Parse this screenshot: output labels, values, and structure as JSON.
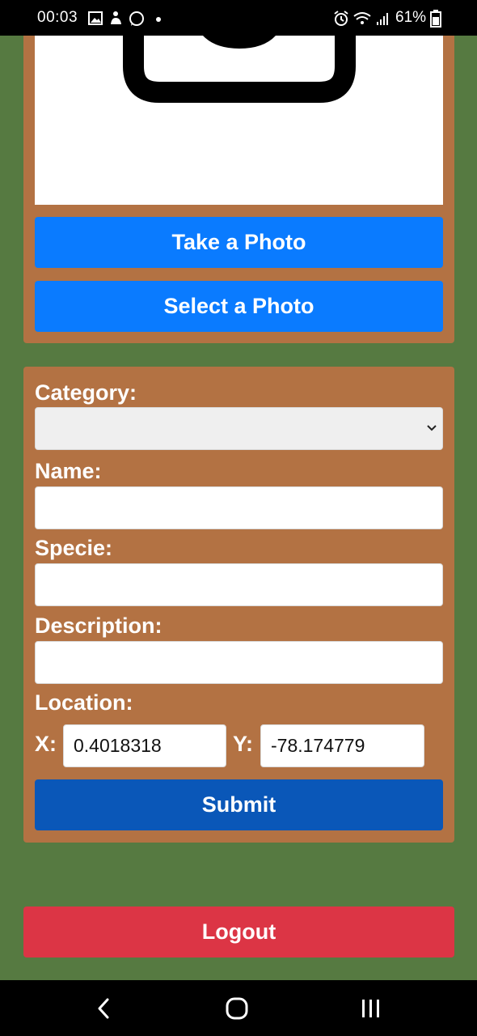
{
  "status_bar": {
    "time": "00:03",
    "battery": "61%",
    "icons_left": [
      "image-icon",
      "fitness-icon",
      "whatsapp-icon",
      "dot-icon"
    ],
    "icons_right": [
      "alarm-icon",
      "wifi-icon",
      "signal-icon",
      "battery-icon"
    ]
  },
  "photo_section": {
    "preview_icon": "camera-icon",
    "take_photo_label": "Take a Photo",
    "select_photo_label": "Select a Photo"
  },
  "form": {
    "category_label": "Category:",
    "category_value": "",
    "name_label": "Name:",
    "name_value": "",
    "specie_label": "Specie:",
    "specie_value": "",
    "description_label": "Description:",
    "description_value": "",
    "location_label": "Location:",
    "x_label": "X:",
    "x_value": "0.4018318",
    "y_label": "Y:",
    "y_value": "-78.174779",
    "submit_label": "Submit"
  },
  "logout_label": "Logout",
  "nav_bar": {
    "buttons": [
      "back-icon",
      "home-icon",
      "recents-icon"
    ]
  },
  "colors": {
    "background": "#567a41",
    "card": "#b37243",
    "primary_button": "#0a7bff",
    "submit_button": "#0a57b8",
    "logout_button": "#dc3545"
  }
}
